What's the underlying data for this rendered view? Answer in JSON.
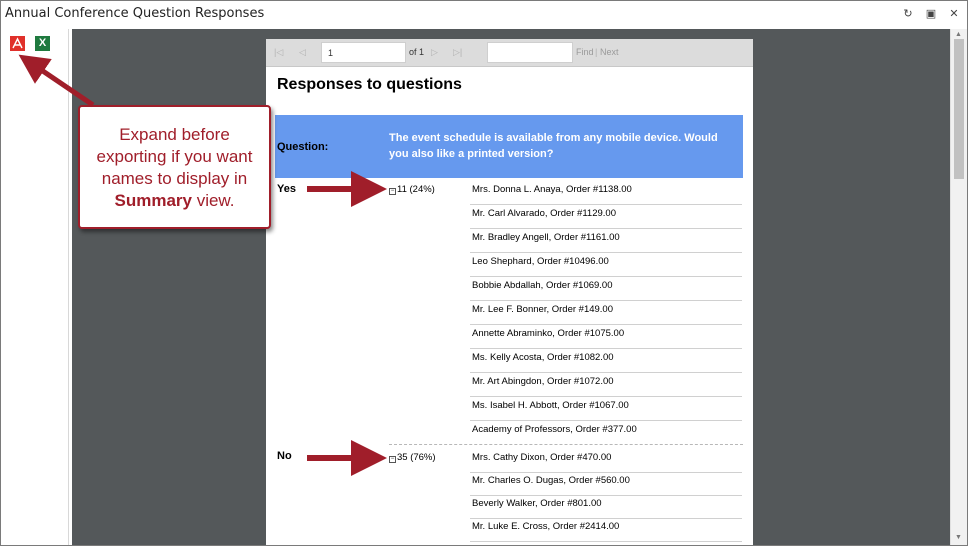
{
  "window": {
    "title": "Annual Conference Question Responses"
  },
  "export": {
    "pdf_glyph": "✉",
    "excel_glyph": "X"
  },
  "toolbar": {
    "page_value": "1",
    "of_label": "of 1",
    "find_label": "Find",
    "separator": "|",
    "next_label": "Next"
  },
  "report": {
    "title": "Responses to questions",
    "question_label": "Question:",
    "question_text": "The event schedule is available from any mobile device. Would you also like a printed version?",
    "answers": [
      {
        "label": "Yes",
        "count": "11 (24%)",
        "names": [
          "Mrs. Donna L. Anaya, Order #1138.00",
          "Mr. Carl Alvarado, Order #1129.00",
          "Mr. Bradley Angell, Order #1161.00",
          "Leo Shephard, Order #10496.00",
          "Bobbie Abdallah, Order #1069.00",
          "Mr. Lee F. Bonner, Order #149.00",
          "Annette Abraminko, Order #1075.00",
          "Ms. Kelly Acosta, Order #1082.00",
          "Mr. Art Abingdon, Order #1072.00",
          "Ms. Isabel H. Abbott, Order #1067.00",
          "Academy of Professors, Order #377.00"
        ]
      },
      {
        "label": "No",
        "count": "35 (76%)",
        "names": [
          "Mrs. Cathy Dixon, Order #470.00",
          "Mr. Charles O. Dugas, Order #560.00",
          "Beverly Walker, Order #801.00",
          "Mr. Luke E. Cross, Order #2414.00"
        ]
      }
    ]
  },
  "callout": {
    "line1": "Expand before",
    "line2": "exporting if you want",
    "line3": "names to display in",
    "bold": "Summary",
    "tail": " view."
  },
  "colors": {
    "question_header": "#6699ee",
    "callout_accent": "#a01e2a",
    "viewer_bg": "#54585a"
  }
}
